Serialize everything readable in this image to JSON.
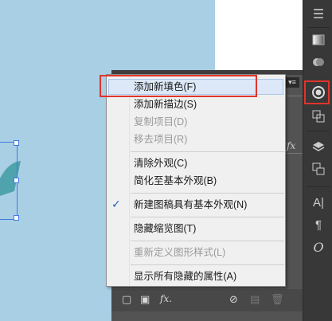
{
  "menu": {
    "items": [
      {
        "label": "添加新填色(F)",
        "enabled": true,
        "highlighted": true
      },
      {
        "label": "添加新描边(S)",
        "enabled": true
      },
      {
        "label": "复制项目(D)",
        "enabled": false
      },
      {
        "label": "移去项目(R)",
        "enabled": false
      },
      {
        "label": "清除外观(C)",
        "enabled": true
      },
      {
        "label": "简化至基本外观(B)",
        "enabled": true
      },
      {
        "label": "新建图稿具有基本外观(N)",
        "enabled": true,
        "checked": true
      },
      {
        "label": "隐藏缩览图(T)",
        "enabled": true
      },
      {
        "label": "重新定义图形样式(L)",
        "enabled": false
      },
      {
        "label": "显示所有隐藏的属性(A)",
        "enabled": true
      }
    ],
    "check_mark": "✓"
  },
  "panel": {
    "fx_label": "fx",
    "footer_fx": "fx.",
    "menu_button_glyph": "▾≡"
  },
  "colors": {
    "canvas_blue": "#a9cfe4",
    "shape_teal": "#4fa3ad",
    "highlight_red": "#e0342c",
    "selection_blue": "#3d7be3",
    "toolbar_dark": "#383838"
  },
  "toolbar": {
    "icons": [
      "menu-icon",
      "gradient-icon",
      "shape-builder-icon",
      "appearance-icon",
      "transform-icon",
      "layers-icon",
      "artboards-icon",
      "character-icon",
      "paragraph-icon",
      "opentype-icon"
    ],
    "glyphs": {
      "character": "A|",
      "paragraph": "¶",
      "opentype": "O"
    }
  }
}
